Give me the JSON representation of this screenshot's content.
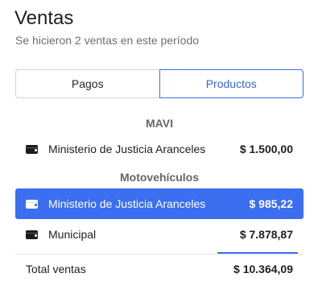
{
  "header": {
    "title": "Ventas",
    "subtitle": "Se hicieron 2 ventas en este período"
  },
  "tabs": [
    {
      "label": "Pagos",
      "active": false
    },
    {
      "label": "Productos",
      "active": true
    }
  ],
  "groups": [
    {
      "name": "MAVI",
      "items": [
        {
          "icon": "wallet-icon",
          "label": "Ministerio de Justicia Aranceles",
          "amount": "$ 1.500,00",
          "selected": false
        }
      ]
    },
    {
      "name": "Motovehículos",
      "items": [
        {
          "icon": "wallet-icon",
          "label": "Ministerio de Justicia Aranceles",
          "amount": "$ 985,22",
          "selected": true
        },
        {
          "icon": "wallet-icon",
          "label": "Municipal",
          "amount": "$ 7.878,87",
          "selected": false
        }
      ]
    }
  ],
  "total": {
    "label": "Total ventas",
    "amount": "$ 10.364,09"
  },
  "colors": {
    "accent": "#3b6ff0",
    "tab_active_text": "#3566d8",
    "muted_text": "#6f6f6f"
  }
}
